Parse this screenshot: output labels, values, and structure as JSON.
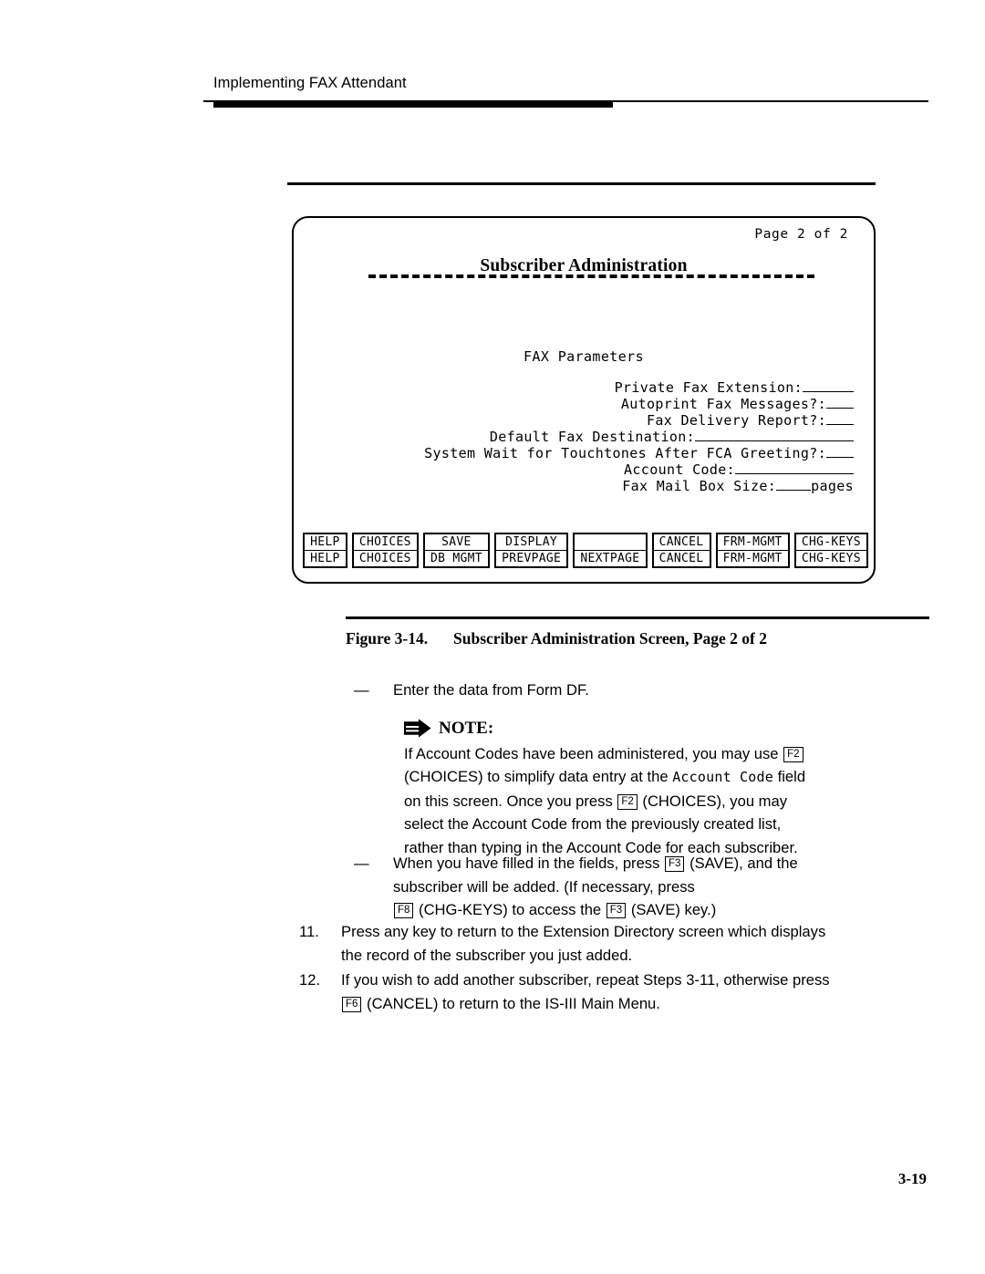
{
  "document": {
    "running_head": "Implementing FAX Attendant",
    "folio": "3-19"
  },
  "screen": {
    "page_indicator": "Page 2 of 2",
    "title": "Subscriber Administration",
    "section_title": "FAX Parameters",
    "fields": [
      {
        "label": "Private Fax Extension:",
        "blank": "b6",
        "suffix": ""
      },
      {
        "label": "Autoprint Fax Messages?:",
        "blank": "b3",
        "suffix": ""
      },
      {
        "label": "Fax Delivery Report?:",
        "blank": "b3",
        "suffix": ""
      },
      {
        "label": "Default Fax Destination:",
        "blank": "b20",
        "suffix": ""
      },
      {
        "label": "System Wait for Touchtones After FCA Greeting?:",
        "blank": "b3",
        "suffix": ""
      },
      {
        "label": "Account Code:",
        "blank": "b15",
        "suffix": ""
      },
      {
        "label": "Fax Mail Box Size:",
        "blank": "b4",
        "suffix": "pages"
      }
    ],
    "softkeys": [
      {
        "top": "HELP",
        "bottom": "HELP"
      },
      {
        "top": "CHOICES",
        "bottom": "CHOICES"
      },
      {
        "top": "SAVE",
        "bottom": "DB MGMT"
      },
      {
        "top": "DISPLAY",
        "bottom": "PREVPAGE"
      },
      {
        "top": "",
        "bottom": "NEXTPAGE"
      },
      {
        "top": "CANCEL",
        "bottom": "CANCEL"
      },
      {
        "top": "FRM-MGMT",
        "bottom": "FRM-MGMT"
      },
      {
        "top": "CHG-KEYS",
        "bottom": "CHG-KEYS"
      }
    ]
  },
  "figure": {
    "number": "Figure 3-14.",
    "title": "Subscriber Administration Screen, Page 2 of 2"
  },
  "body": {
    "bullet_marker": "—",
    "item_enter_data": "Enter the data from Form DF.",
    "note": {
      "heading": "NOTE:",
      "line1_a": "If Account Codes have been administered, you may use",
      "line1_key": "F2",
      "line2_a": "(CHOICES) to simplify data entry at the",
      "line2_code": "Account Code",
      "line2_b": "field",
      "line3_a": "on this screen.  Once you press",
      "line3_key": "F2",
      "line3_b": "(CHOICES), you may",
      "line4": "select the Account Code from the previously created list,",
      "line5": "rather than typing in the Account Code for each subscriber."
    },
    "item_save": {
      "line1_a": "When you have filled in the fields, press",
      "line1_key": "F3",
      "line1_b": "(SAVE), and the",
      "line2": "subscriber will be added.  (If necessary, press",
      "line3_key1": "F8",
      "line3_a": "(CHG-KEYS) to access the",
      "line3_key2": "F3",
      "line3_b": "(SAVE) key.)"
    },
    "step11": {
      "number": "11.",
      "line1": "Press any key to return to the Extension Directory screen which displays",
      "line2": "the record of the subscriber you just added."
    },
    "step12": {
      "number": "12.",
      "line1": "If you wish to add another subscriber, repeat Steps 3-11, otherwise press",
      "line2_key": "F6",
      "line2_a": "(CANCEL) to return to the IS-III Main Menu."
    }
  }
}
